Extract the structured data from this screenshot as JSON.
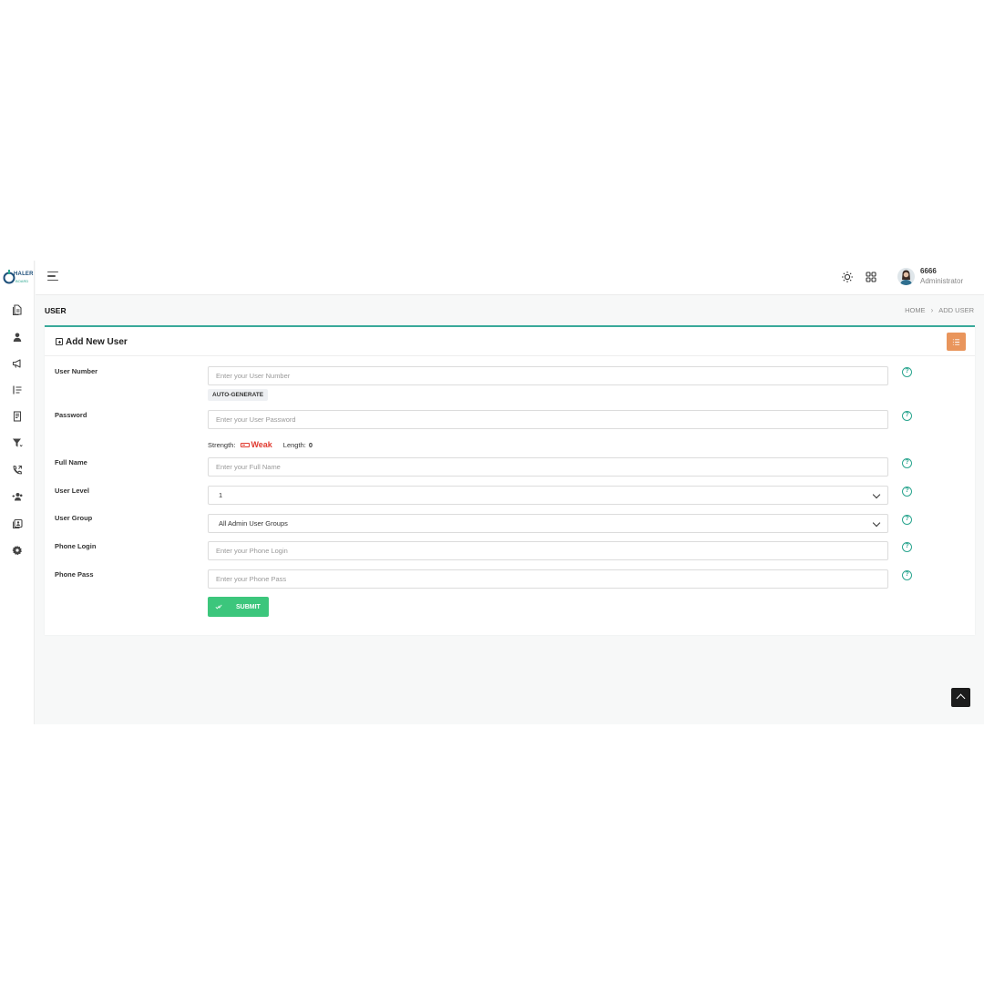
{
  "brand": {
    "logo_text": "HALER",
    "logo_sub": "BOARD"
  },
  "topbar": {
    "user_name": "6666",
    "user_role": "Administrator"
  },
  "page": {
    "title": "USER",
    "breadcrumb": {
      "home": "HOME",
      "separator": "›",
      "current": "ADD USER"
    }
  },
  "card": {
    "title": "Add New User"
  },
  "form": {
    "user_number": {
      "label": "User Number",
      "placeholder": "Enter your User Number"
    },
    "auto_generate_label": "AUTO-GENERATE",
    "password": {
      "label": "Password",
      "placeholder": "Enter your User Password"
    },
    "strength": {
      "label": "Strength:",
      "value": "Weak",
      "length_label": "Length:",
      "length_value": "0"
    },
    "full_name": {
      "label": "Full Name",
      "placeholder": "Enter your Full Name"
    },
    "user_level": {
      "label": "User Level",
      "value": "1"
    },
    "user_group": {
      "label": "User Group",
      "value": "All Admin User Groups"
    },
    "phone_login": {
      "label": "Phone Login",
      "placeholder": "Enter your Phone Login"
    },
    "phone_pass": {
      "label": "Phone Pass",
      "placeholder": "Enter your Phone Pass"
    },
    "submit_label": "SUBMIT"
  },
  "colors": {
    "accent": "#39a99a",
    "submit": "#3cc67c",
    "list_button": "#e9955c",
    "weak": "#e03a2f"
  },
  "icons": {
    "sidebar": [
      "document-icon",
      "user-icon",
      "megaphone-icon",
      "list-icon",
      "report-icon",
      "filter-icon",
      "phone-call-icon",
      "users-add-icon",
      "contacts-icon",
      "settings-icon"
    ],
    "topbar": [
      "menu-icon",
      "sun-icon",
      "apps-grid-icon"
    ],
    "help": "question-circle-icon"
  }
}
